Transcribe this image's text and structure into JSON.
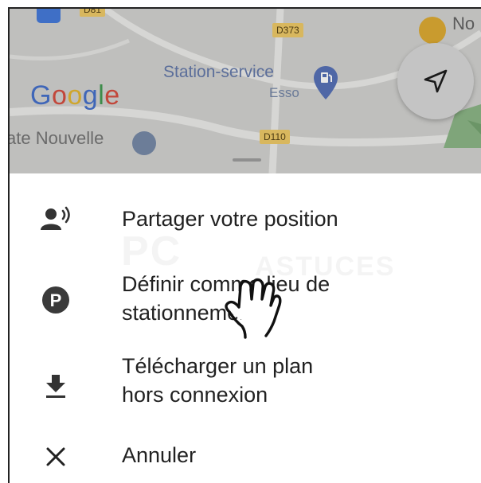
{
  "map": {
    "road_labels": [
      "D81",
      "D373",
      "D110"
    ],
    "poi_name": "Station-service",
    "poi_brand": "Esso",
    "place_partial": "ate Nouvelle",
    "place_right_partial": "No",
    "logo": "Google"
  },
  "sheet": {
    "items": [
      {
        "label": "Partager votre position",
        "icon": "share-location-icon"
      },
      {
        "label": "Définir comme lieu de\nstationnement",
        "icon": "parking-icon"
      },
      {
        "label": "Télécharger un plan\nhors connexion",
        "icon": "download-icon"
      },
      {
        "label": "Annuler",
        "icon": "close-icon"
      }
    ]
  },
  "watermark": {
    "line1": "PC",
    "line2": "ASTUCES"
  },
  "colors": {
    "map_dim": "#bfbfbd",
    "road_label": "#d8b75e",
    "text": "#212121",
    "icon": "#333333"
  }
}
